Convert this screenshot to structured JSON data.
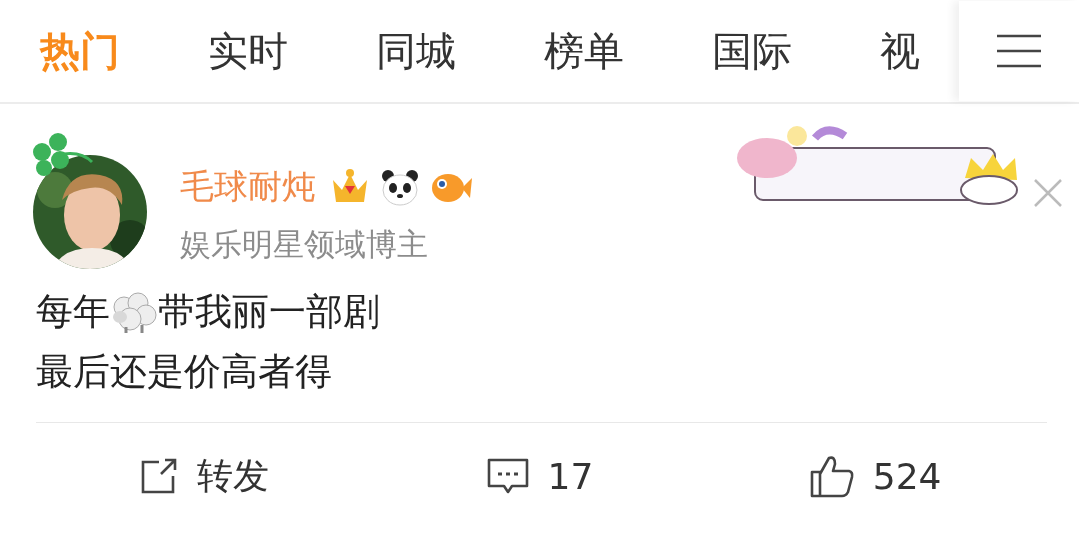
{
  "tabs": [
    {
      "label": "热门",
      "selected": true
    },
    {
      "label": "实时",
      "selected": false
    },
    {
      "label": "同城",
      "selected": false
    },
    {
      "label": "榜单",
      "selected": false
    },
    {
      "label": "国际",
      "selected": false
    },
    {
      "label": "视",
      "selected": false
    }
  ],
  "post": {
    "user_name": "毛球耐炖",
    "user_title": "娱乐明星领域博主",
    "lines": [
      {
        "parts": [
          "每年",
          "带我丽一部剧"
        ]
      },
      {
        "parts": [
          "最后还是价高者得"
        ]
      }
    ],
    "actions": [
      {
        "kind": "repost",
        "label": "转发"
      },
      {
        "kind": "comment",
        "label": "17"
      },
      {
        "kind": "like",
        "label": "524"
      }
    ]
  }
}
